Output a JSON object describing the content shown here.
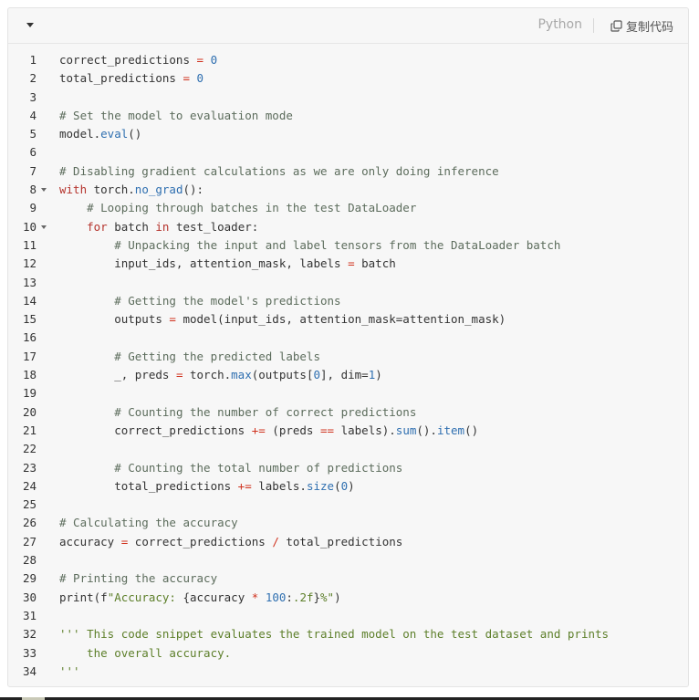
{
  "header": {
    "collapse_icon": "chevron-down-icon",
    "language": "Python",
    "copy_label": "复制代码",
    "copy_icon": "copy-icon"
  },
  "code": {
    "lines": [
      {
        "n": "1",
        "fold": false,
        "text": "correct_predictions = 0",
        "tokens": [
          [
            "correct_predictions ",
            "i"
          ],
          [
            "=",
            "o"
          ],
          [
            " ",
            "p"
          ],
          [
            "0",
            "n"
          ]
        ]
      },
      {
        "n": "2",
        "fold": false,
        "text": "total_predictions = 0",
        "tokens": [
          [
            "total_predictions ",
            "i"
          ],
          [
            "=",
            "o"
          ],
          [
            " ",
            "p"
          ],
          [
            "0",
            "n"
          ]
        ]
      },
      {
        "n": "3",
        "fold": false,
        "text": "",
        "tokens": []
      },
      {
        "n": "4",
        "fold": false,
        "text": "# Set the model to evaluation mode",
        "tokens": [
          [
            "# Set the model to evaluation mode",
            "c"
          ]
        ]
      },
      {
        "n": "5",
        "fold": false,
        "text": "model.eval()",
        "tokens": [
          [
            "model.",
            "i"
          ],
          [
            "eval",
            "f"
          ],
          [
            "()",
            "p"
          ]
        ]
      },
      {
        "n": "6",
        "fold": false,
        "text": "",
        "tokens": []
      },
      {
        "n": "7",
        "fold": false,
        "text": "# Disabling gradient calculations as we are only doing inference",
        "tokens": [
          [
            "# Disabling gradient calculations as we are only doing inference",
            "c"
          ]
        ]
      },
      {
        "n": "8",
        "fold": true,
        "text": "with torch.no_grad():",
        "tokens": [
          [
            "with",
            "k"
          ],
          [
            " torch.",
            "i"
          ],
          [
            "no_grad",
            "f"
          ],
          [
            "():",
            "p"
          ]
        ]
      },
      {
        "n": "9",
        "fold": false,
        "text": "    # Looping through batches in the test DataLoader",
        "tokens": [
          [
            "    ",
            "p"
          ],
          [
            "# Looping through batches in the test DataLoader",
            "c"
          ]
        ]
      },
      {
        "n": "10",
        "fold": true,
        "text": "    for batch in test_loader:",
        "tokens": [
          [
            "    ",
            "p"
          ],
          [
            "for",
            "k"
          ],
          [
            " batch ",
            "i"
          ],
          [
            "in",
            "k"
          ],
          [
            " test_loader:",
            "i"
          ]
        ]
      },
      {
        "n": "11",
        "fold": false,
        "text": "        # Unpacking the input and label tensors from the DataLoader batch",
        "tokens": [
          [
            "        ",
            "p"
          ],
          [
            "# Unpacking the input and label tensors from the DataLoader batch",
            "c"
          ]
        ]
      },
      {
        "n": "12",
        "fold": false,
        "text": "        input_ids, attention_mask, labels = batch",
        "tokens": [
          [
            "        input_ids, attention_mask, labels ",
            "i"
          ],
          [
            "=",
            "o"
          ],
          [
            " batch",
            "i"
          ]
        ]
      },
      {
        "n": "13",
        "fold": false,
        "text": "",
        "tokens": []
      },
      {
        "n": "14",
        "fold": false,
        "text": "        # Getting the model's predictions",
        "tokens": [
          [
            "        ",
            "p"
          ],
          [
            "# Getting the model's predictions",
            "c"
          ]
        ]
      },
      {
        "n": "15",
        "fold": false,
        "text": "        outputs = model(input_ids, attention_mask=attention_mask)",
        "tokens": [
          [
            "        outputs ",
            "i"
          ],
          [
            "=",
            "o"
          ],
          [
            " model(input_ids, attention_mask=attention_mask)",
            "i"
          ]
        ]
      },
      {
        "n": "16",
        "fold": false,
        "text": "",
        "tokens": []
      },
      {
        "n": "17",
        "fold": false,
        "text": "        # Getting the predicted labels",
        "tokens": [
          [
            "        ",
            "p"
          ],
          [
            "# Getting the predicted labels",
            "c"
          ]
        ]
      },
      {
        "n": "18",
        "fold": false,
        "text": "        _, preds = torch.max(outputs[0], dim=1)",
        "tokens": [
          [
            "        _, preds ",
            "i"
          ],
          [
            "=",
            "o"
          ],
          [
            " torch.",
            "i"
          ],
          [
            "max",
            "f"
          ],
          [
            "(outputs[",
            "p"
          ],
          [
            "0",
            "n"
          ],
          [
            "], dim=",
            "p"
          ],
          [
            "1",
            "n"
          ],
          [
            ")",
            "p"
          ]
        ]
      },
      {
        "n": "19",
        "fold": false,
        "text": "",
        "tokens": []
      },
      {
        "n": "20",
        "fold": false,
        "text": "        # Counting the number of correct predictions",
        "tokens": [
          [
            "        ",
            "p"
          ],
          [
            "# Counting the number of correct predictions",
            "c"
          ]
        ]
      },
      {
        "n": "21",
        "fold": false,
        "text": "        correct_predictions += (preds == labels).sum().item()",
        "tokens": [
          [
            "        correct_predictions ",
            "i"
          ],
          [
            "+=",
            "o"
          ],
          [
            " (preds ",
            "i"
          ],
          [
            "==",
            "o"
          ],
          [
            " labels).",
            "i"
          ],
          [
            "sum",
            "f"
          ],
          [
            "().",
            "p"
          ],
          [
            "item",
            "f"
          ],
          [
            "()",
            "p"
          ]
        ]
      },
      {
        "n": "22",
        "fold": false,
        "text": "",
        "tokens": []
      },
      {
        "n": "23",
        "fold": false,
        "text": "        # Counting the total number of predictions",
        "tokens": [
          [
            "        ",
            "p"
          ],
          [
            "# Counting the total number of predictions",
            "c"
          ]
        ]
      },
      {
        "n": "24",
        "fold": false,
        "text": "        total_predictions += labels.size(0)",
        "tokens": [
          [
            "        total_predictions ",
            "i"
          ],
          [
            "+=",
            "o"
          ],
          [
            " labels.",
            "i"
          ],
          [
            "size",
            "f"
          ],
          [
            "(",
            "p"
          ],
          [
            "0",
            "n"
          ],
          [
            ")",
            "p"
          ]
        ]
      },
      {
        "n": "25",
        "fold": false,
        "text": "",
        "tokens": []
      },
      {
        "n": "26",
        "fold": false,
        "text": "# Calculating the accuracy",
        "tokens": [
          [
            "# Calculating the accuracy",
            "c"
          ]
        ]
      },
      {
        "n": "27",
        "fold": false,
        "text": "accuracy = correct_predictions / total_predictions",
        "tokens": [
          [
            "accuracy ",
            "i"
          ],
          [
            "=",
            "o"
          ],
          [
            " correct_predictions ",
            "i"
          ],
          [
            "/",
            "o"
          ],
          [
            " total_predictions",
            "i"
          ]
        ]
      },
      {
        "n": "28",
        "fold": false,
        "text": "",
        "tokens": []
      },
      {
        "n": "29",
        "fold": false,
        "text": "# Printing the accuracy",
        "tokens": [
          [
            "# Printing the accuracy",
            "c"
          ]
        ]
      },
      {
        "n": "30",
        "fold": false,
        "text": "print(f\"Accuracy: {accuracy * 100:.2f}%\")",
        "tokens": [
          [
            "print(f",
            "i"
          ],
          [
            "\"Accuracy: ",
            "s"
          ],
          [
            "{accuracy ",
            "i"
          ],
          [
            "*",
            "o"
          ],
          [
            " ",
            "p"
          ],
          [
            "100",
            "n"
          ],
          [
            ":",
            "p"
          ],
          [
            ".2f",
            "s"
          ],
          [
            "}",
            "i"
          ],
          [
            "%\"",
            "s"
          ],
          [
            ")",
            "p"
          ]
        ]
      },
      {
        "n": "31",
        "fold": false,
        "text": "",
        "tokens": []
      },
      {
        "n": "32",
        "fold": false,
        "text": "''' This code snippet evaluates the trained model on the test dataset and prints",
        "tokens": [
          [
            "''' This code snippet evaluates the trained model on the test dataset and prints",
            "s"
          ]
        ]
      },
      {
        "n": "33",
        "fold": false,
        "text": "    the overall accuracy.",
        "tokens": [
          [
            "    the overall accuracy.",
            "s"
          ]
        ]
      },
      {
        "n": "34",
        "fold": false,
        "text": "'''",
        "tokens": [
          [
            "'''",
            "s"
          ]
        ]
      }
    ]
  },
  "colors": {
    "background": "#f7f7f7",
    "border": "#e4e4e4",
    "comment": "#5c6c5c",
    "keyword": "#b5332c",
    "operator": "#d0331f",
    "number": "#2f6fb0",
    "function": "#2f6fb0",
    "string": "#5d7f2a"
  }
}
